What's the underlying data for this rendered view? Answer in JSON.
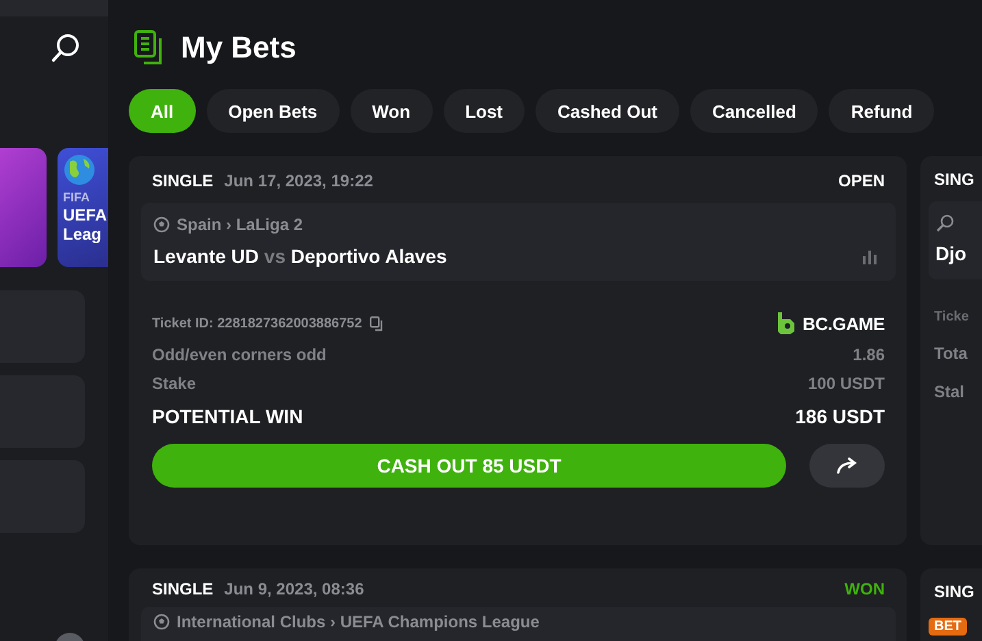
{
  "sidebar": {
    "promo": {
      "category": "FIFA",
      "lines": [
        "UEFA",
        "Leag"
      ]
    }
  },
  "header": {
    "title": "My Bets"
  },
  "filters": [
    {
      "label": "All",
      "selected": true
    },
    {
      "label": "Open Bets",
      "selected": false
    },
    {
      "label": "Won",
      "selected": false
    },
    {
      "label": "Lost",
      "selected": false
    },
    {
      "label": "Cashed Out",
      "selected": false
    },
    {
      "label": "Cancelled",
      "selected": false
    },
    {
      "label": "Refund",
      "selected": false
    }
  ],
  "bets": [
    {
      "kind": "full",
      "type": "SINGLE",
      "date": "Jun 17, 2023, 19:22",
      "status": {
        "label": "OPEN",
        "color": "#ffffff"
      },
      "event": {
        "kind": "soccer",
        "league": "Spain › LaLiga 2"
      },
      "home": "Levante UD",
      "vs": "vs",
      "away": "Deportivo Alaves",
      "ticket": "Ticket ID: 2281827362003886752",
      "brand": "BC.GAME",
      "rows": [
        {
          "label": "Odd/even corners odd",
          "value": "1.86",
          "kind": "plain"
        },
        {
          "label": "Stake",
          "value": "100 USDT",
          "kind": "plain"
        },
        {
          "label": "POTENTIAL WIN",
          "value": "186 USDT",
          "kind": "total"
        }
      ],
      "cashout": "CASH OUT 85 USDT"
    },
    {
      "kind": "partial",
      "type": "SING",
      "event": {
        "kind": "tennis",
        "teams": "Djo"
      },
      "lines": [
        "Ticke",
        "Tota",
        "Stal"
      ]
    },
    {
      "kind": "full",
      "type": "SINGLE",
      "date": "Jun 9, 2023, 08:36",
      "status": {
        "label": "WON",
        "color": "#3fb20d"
      },
      "event": {
        "kind": "soccer",
        "league": "International Clubs › UEFA Champions League"
      }
    },
    {
      "kind": "partial",
      "type": "SING",
      "badge": "BET"
    }
  ]
}
